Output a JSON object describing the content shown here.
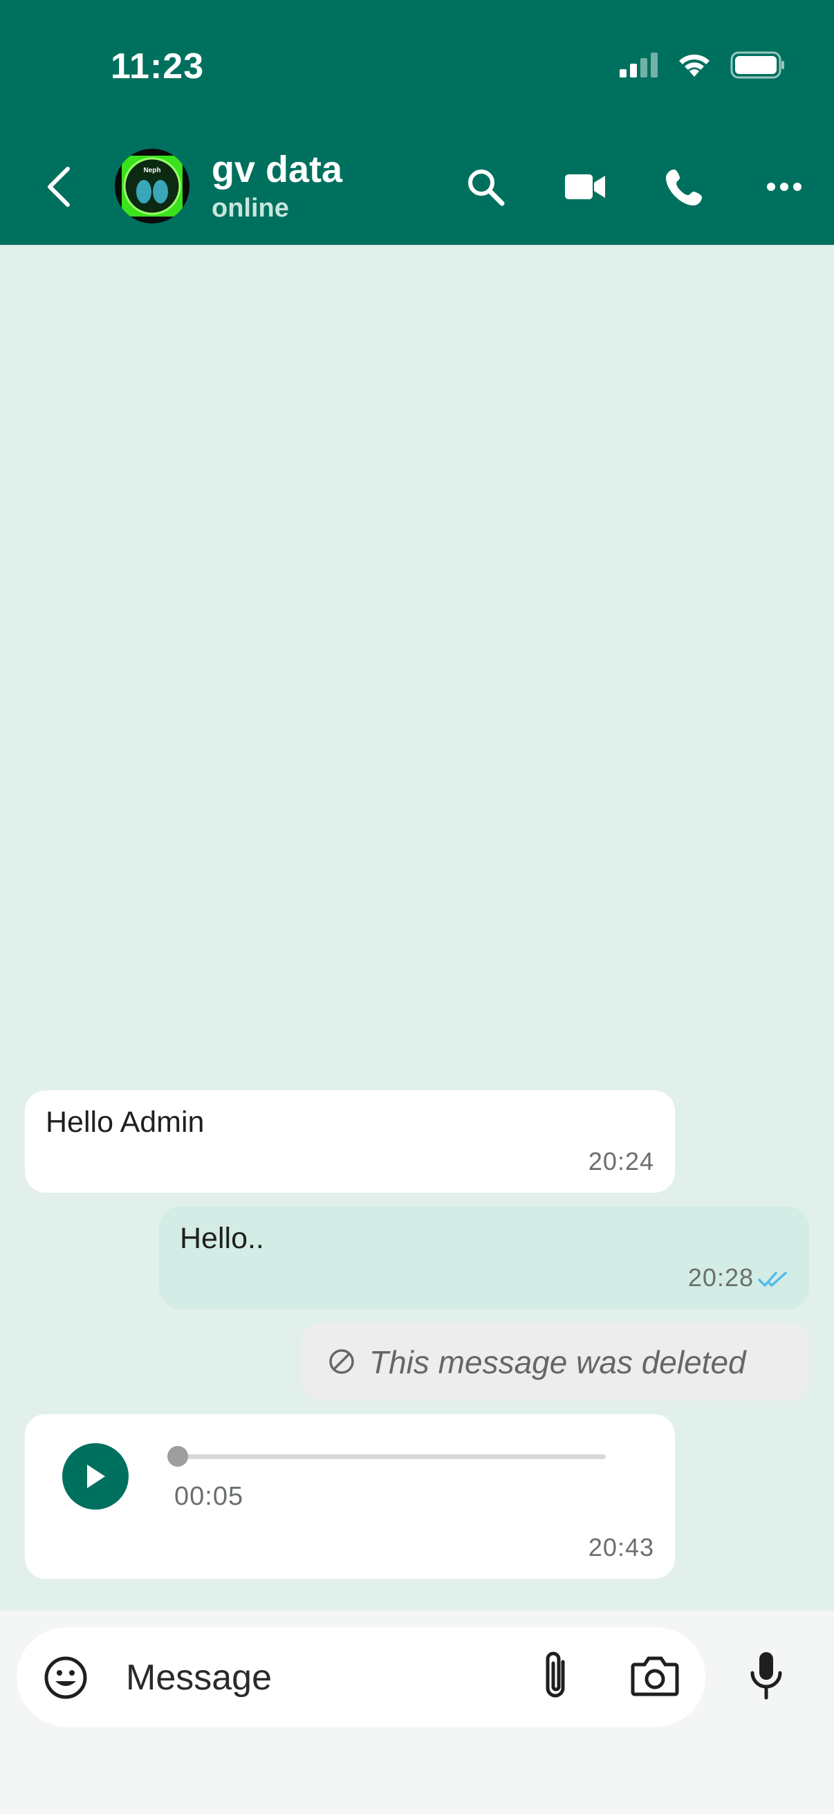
{
  "status_bar": {
    "time": "11:23"
  },
  "header": {
    "contact_name": "gv data",
    "contact_status": "online",
    "avatar_text": "Neph"
  },
  "messages": [
    {
      "direction": "incoming",
      "text": "Hello Admin",
      "time": "20:24"
    },
    {
      "direction": "outgoing",
      "text": "Hello..",
      "time": "20:28",
      "read_receipt": "double-check-read"
    },
    {
      "direction": "outgoing",
      "type": "deleted",
      "text": "This message was deleted"
    },
    {
      "direction": "incoming",
      "type": "voice",
      "duration": "00:05",
      "time": "20:43",
      "progress": 0
    }
  ],
  "composer": {
    "placeholder": "Message"
  },
  "icons": {
    "back": "chevron-left-icon",
    "search": "search-icon",
    "video": "video-camera-icon",
    "call": "phone-icon",
    "more": "more-horizontal-icon",
    "emoji": "emoji-icon",
    "attach": "paperclip-icon",
    "camera": "camera-icon",
    "mic": "microphone-icon"
  },
  "colors": {
    "header": "#00705e",
    "chat_background": "#e2f0ec",
    "outgoing_bubble": "#d3ece6",
    "read_ticks": "#53bdeb"
  }
}
